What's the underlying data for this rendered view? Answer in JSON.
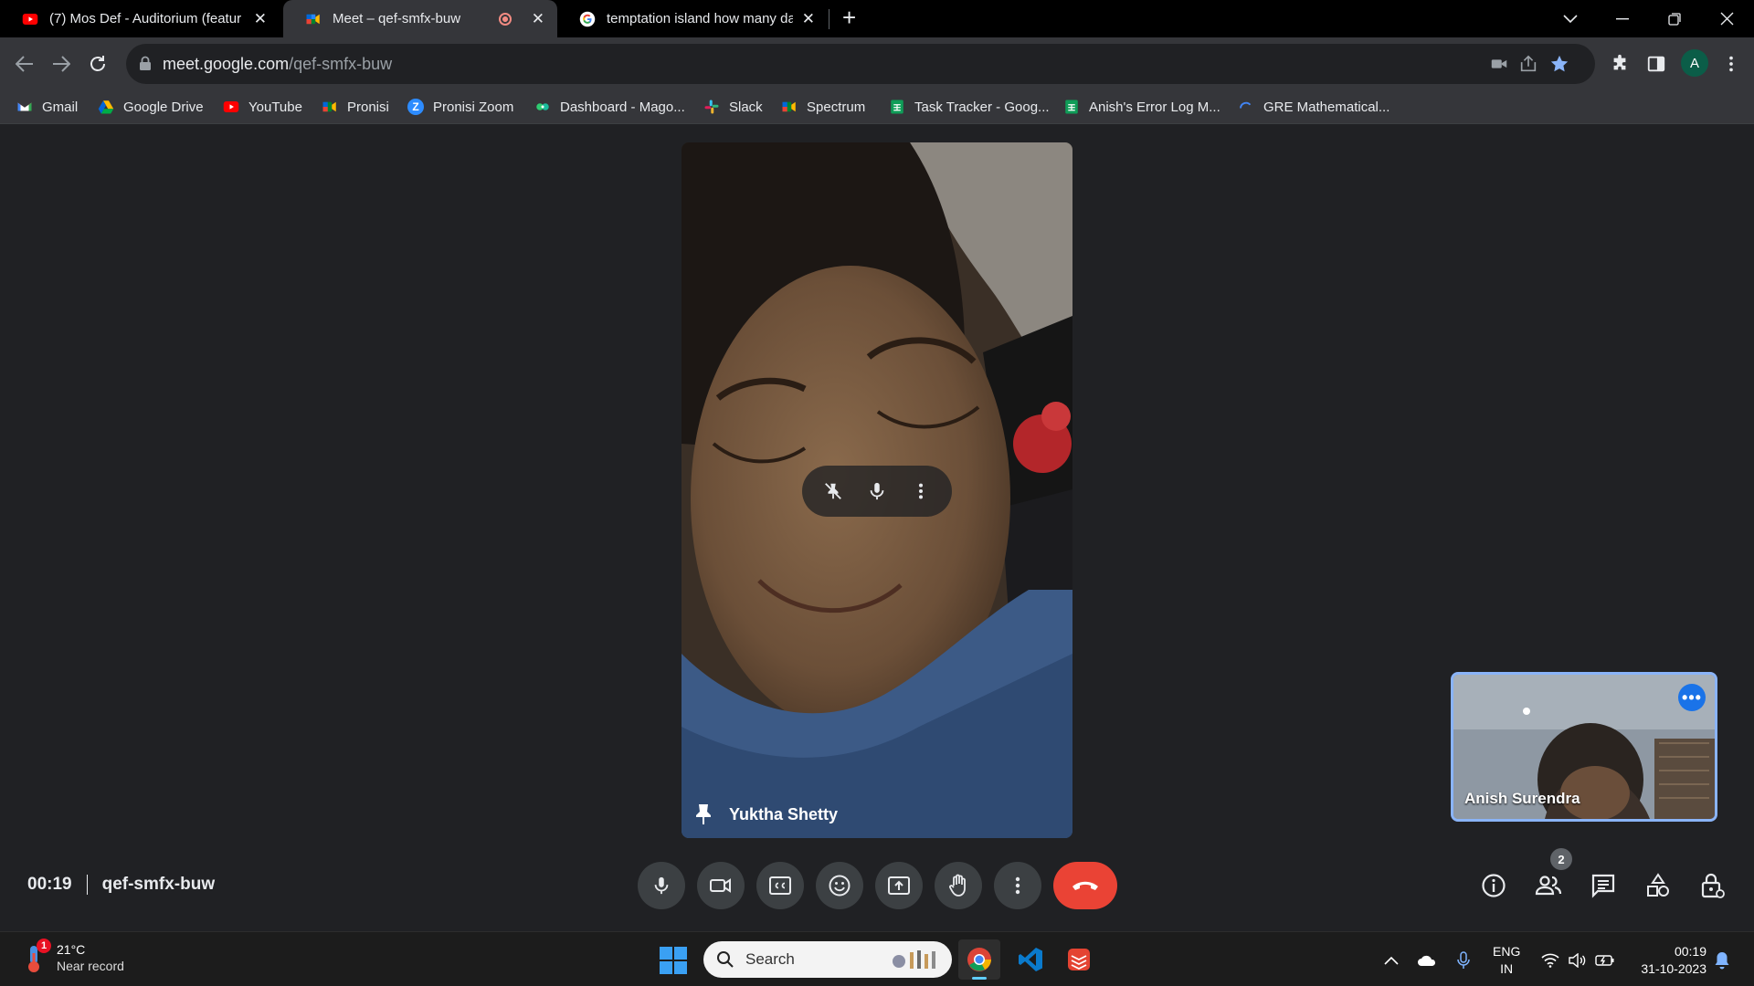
{
  "browser": {
    "tabs": [
      {
        "title": "(7) Mos Def - Auditorium (featur",
        "icon": "youtube-icon",
        "active": false
      },
      {
        "title": "Meet – qef-smfx-buw",
        "icon": "google-meet-icon",
        "active": true,
        "recording": true
      },
      {
        "title": "temptation island how many day",
        "icon": "google-icon",
        "active": false
      }
    ],
    "url_host": "meet.google.com",
    "url_path": "/qef-smfx-buw",
    "profile_initial": "A",
    "bookmarks": [
      {
        "label": "Gmail",
        "icon": "gmail-icon"
      },
      {
        "label": "Google Drive",
        "icon": "google-drive-icon"
      },
      {
        "label": "YouTube",
        "icon": "youtube-icon"
      },
      {
        "label": "Pronisi",
        "icon": "google-meet-icon"
      },
      {
        "label": "Pronisi Zoom",
        "icon": "zoom-icon"
      },
      {
        "label": "Dashboard - Mago...",
        "icon": "dashboard-icon"
      },
      {
        "label": "Slack",
        "icon": "slack-icon"
      },
      {
        "label": "Spectrum",
        "icon": "google-meet-icon"
      },
      {
        "label": "Task Tracker - Goog...",
        "icon": "google-sheets-icon"
      },
      {
        "label": "Anish's Error Log M...",
        "icon": "google-sheets-icon"
      },
      {
        "label": "GRE Mathematical...",
        "icon": "loading-icon"
      }
    ]
  },
  "meet": {
    "main_participant": "Yuktha Shetty",
    "self_participant": "Anish Surendra",
    "elapsed": "00:19",
    "meeting_code": "qef-smfx-buw",
    "participant_count": "2"
  },
  "taskbar": {
    "weather_temp": "21°C",
    "weather_cond": "Near record",
    "weather_badge": "1",
    "search_label": "Search",
    "lang_line1": "ENG",
    "lang_line2": "IN",
    "time": "00:19",
    "date": "31-10-2023"
  },
  "colors": {
    "meet_bg": "#202124",
    "end_call": "#ea4335",
    "accent_blue": "#8ab4f8",
    "control_bg": "#3c4043"
  }
}
